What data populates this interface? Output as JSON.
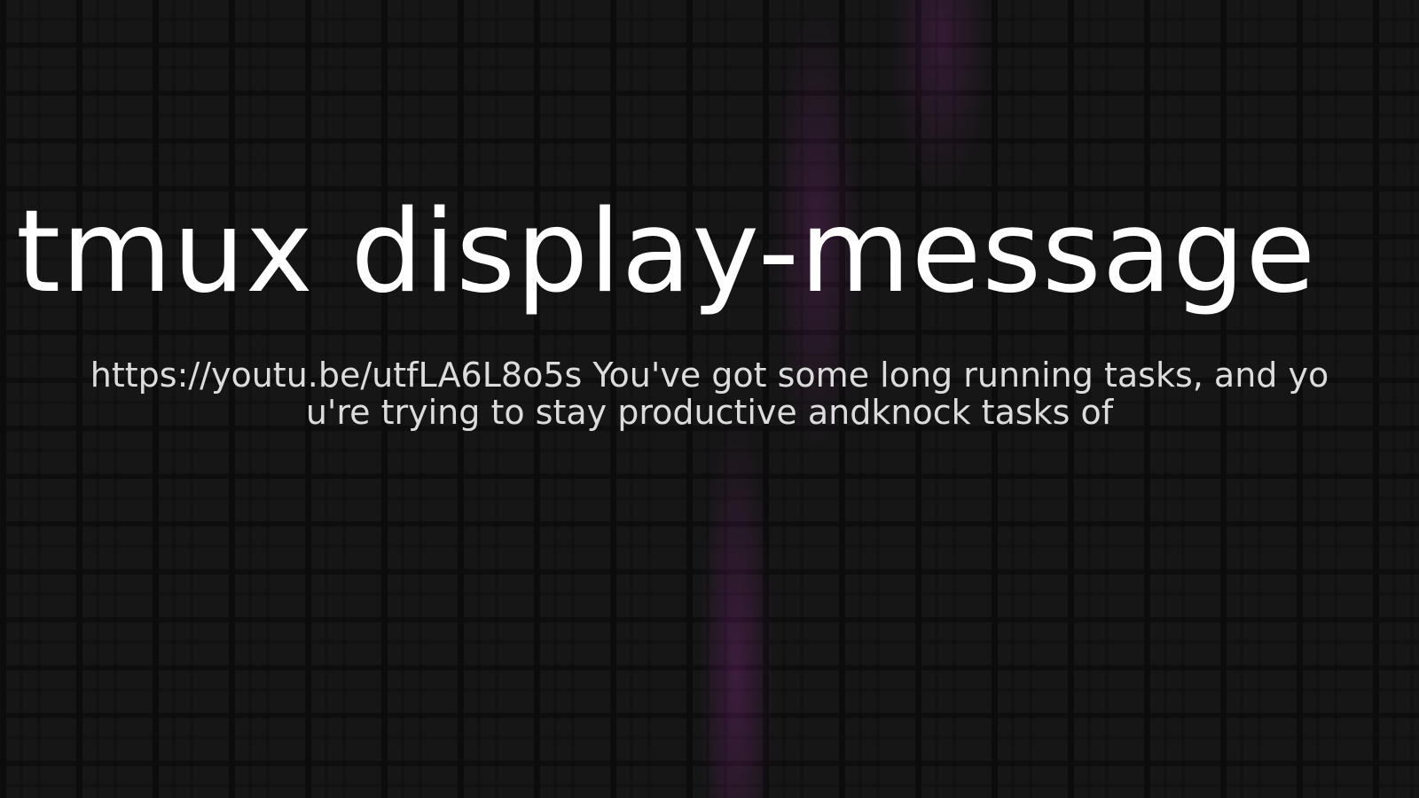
{
  "title": "tmux display-message",
  "description": "https://youtu.be/utfLA6L8o5s You've got some long running tasks, and you're trying to stay productive andknock tasks of",
  "colors": {
    "background": "#171717",
    "title_text": "#ffffff",
    "description_text": "#dcdcdc",
    "accent_glow": "#781478"
  }
}
